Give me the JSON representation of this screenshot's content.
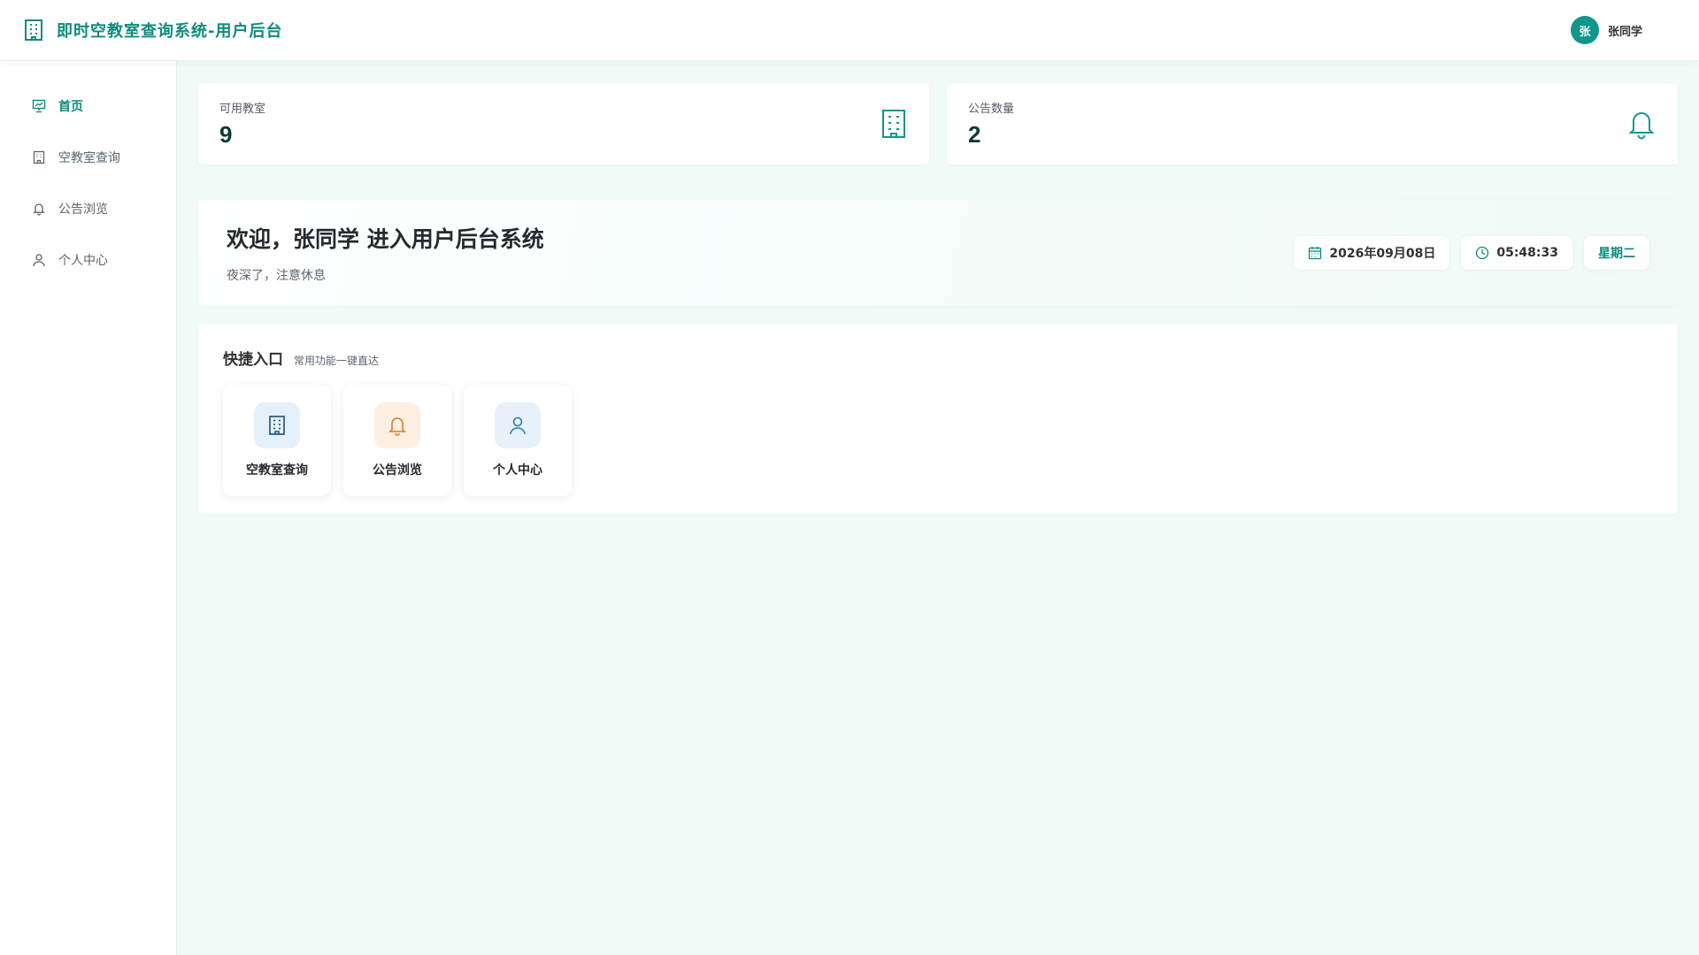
{
  "header": {
    "title": "即时空教室查询系统-用户后台",
    "logo_icon": "building-icon",
    "user": {
      "avatar_text": "张",
      "name": "张同学"
    }
  },
  "sidebar": {
    "items": [
      {
        "label": "首页",
        "icon": "presentation-icon",
        "active": true
      },
      {
        "label": "空教室查询",
        "icon": "building-icon",
        "active": false
      },
      {
        "label": "公告浏览",
        "icon": "bell-icon",
        "active": false
      },
      {
        "label": "个人中心",
        "icon": "user-icon",
        "active": false
      }
    ]
  },
  "stats": [
    {
      "label": "可用教室",
      "value": "9",
      "icon": "building-icon"
    },
    {
      "label": "公告数量",
      "value": "2",
      "icon": "bell-icon"
    }
  ],
  "welcome": {
    "title": "欢迎，张同学 进入用户后台系统",
    "subtitle": "夜深了，注意休息",
    "date": "2026年09月08日",
    "time": "05:48:33",
    "weekday": "星期二"
  },
  "quick": {
    "title": "快捷入口",
    "subtitle": "常用功能一键直达",
    "items": [
      {
        "label": "空教室查询",
        "icon": "building-icon",
        "color": "#1f4e79",
        "bg": "#e4f0fa"
      },
      {
        "label": "公告浏览",
        "icon": "bell-icon",
        "color": "#e07b1f",
        "bg": "#fdefe2"
      },
      {
        "label": "个人中心",
        "icon": "user-icon",
        "color": "#2b7bb9",
        "bg": "#e6f1fa"
      }
    ]
  },
  "colors": {
    "primary": "#0f8a7e",
    "background": "#f0fbf8"
  }
}
